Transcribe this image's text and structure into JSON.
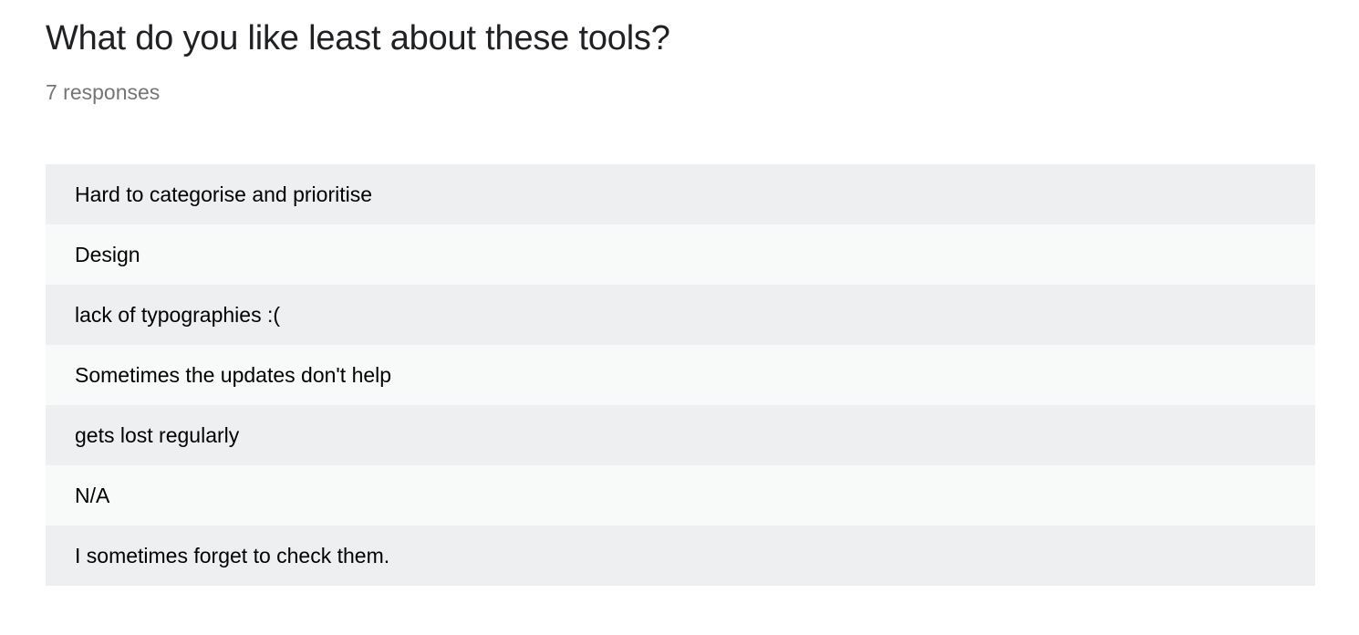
{
  "question": {
    "title": "What do you like least about these tools?",
    "response_count": "7 responses"
  },
  "responses": [
    "Hard to categorise and prioritise",
    "Design",
    "lack of typographies :(",
    "Sometimes the updates don't help",
    "gets lost regularly",
    "N/A",
    "I sometimes forget to check them."
  ],
  "colors": {
    "row_odd": "#eeeff1",
    "row_even": "#f8f9f9",
    "title_text": "#202124",
    "count_text": "#757575"
  }
}
